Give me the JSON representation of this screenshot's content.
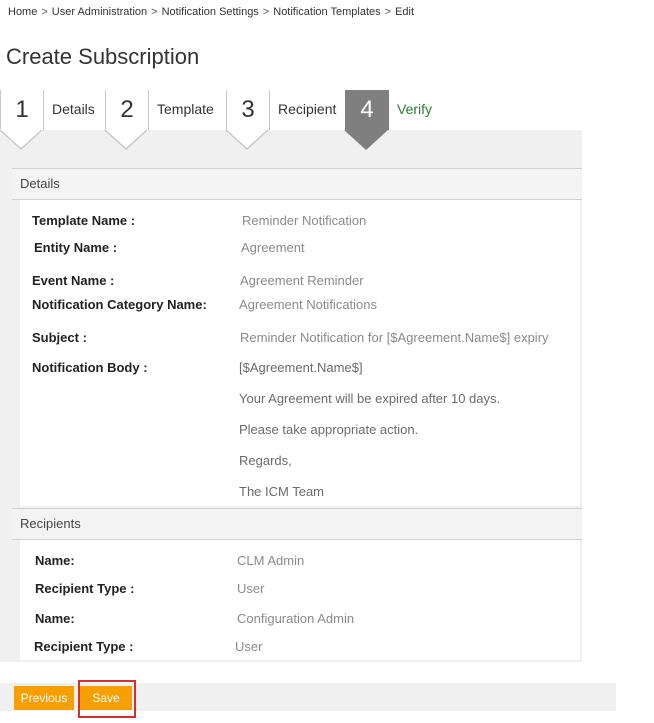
{
  "breadcrumb": {
    "items": [
      "Home",
      "User Administration",
      "Notification Settings",
      "Notification Templates",
      "Edit"
    ],
    "separator": ">"
  },
  "page_title": "Create Subscription",
  "steps": [
    {
      "number": "1",
      "label": "Details"
    },
    {
      "number": "2",
      "label": "Template"
    },
    {
      "number": "3",
      "label": "Recipient"
    },
    {
      "number": "4",
      "label": "Verify",
      "active": true
    }
  ],
  "details": {
    "header": "Details",
    "template_name_label": "Template Name :",
    "template_name": "Reminder Notification",
    "entity_name_label": "Entity Name :",
    "entity_name": "Agreement",
    "event_name_label": "Event Name :",
    "event_name": "Agreement Reminder",
    "category_label": "Notification Category Name:",
    "category": "Agreement Notifications",
    "subject_label": "Subject :",
    "subject": "Reminder Notification for [$Agreement.Name$] expiry",
    "body_label": "Notification Body :",
    "body_lines": [
      "[$Agreement.Name$]",
      "Your Agreement will be expired after 10 days.",
      "Please take appropriate action.",
      "Regards,",
      "The ICM Team"
    ]
  },
  "recipients": {
    "header": "Recipients",
    "items": [
      {
        "name_label": "Name:",
        "name": "CLM Admin",
        "type_label": "Recipient Type :",
        "type": "User"
      },
      {
        "name_label": "Name:",
        "name": "Configuration  Admin",
        "type_label": "Recipient Type :",
        "type": "User"
      }
    ]
  },
  "footer": {
    "previous_label": "Previous",
    "save_label": "Save"
  },
  "colors": {
    "accent_button": "#f5a000",
    "active_step": "#7f7f7f",
    "active_step_label": "#2e7d32",
    "highlight": "#d32f2f"
  }
}
